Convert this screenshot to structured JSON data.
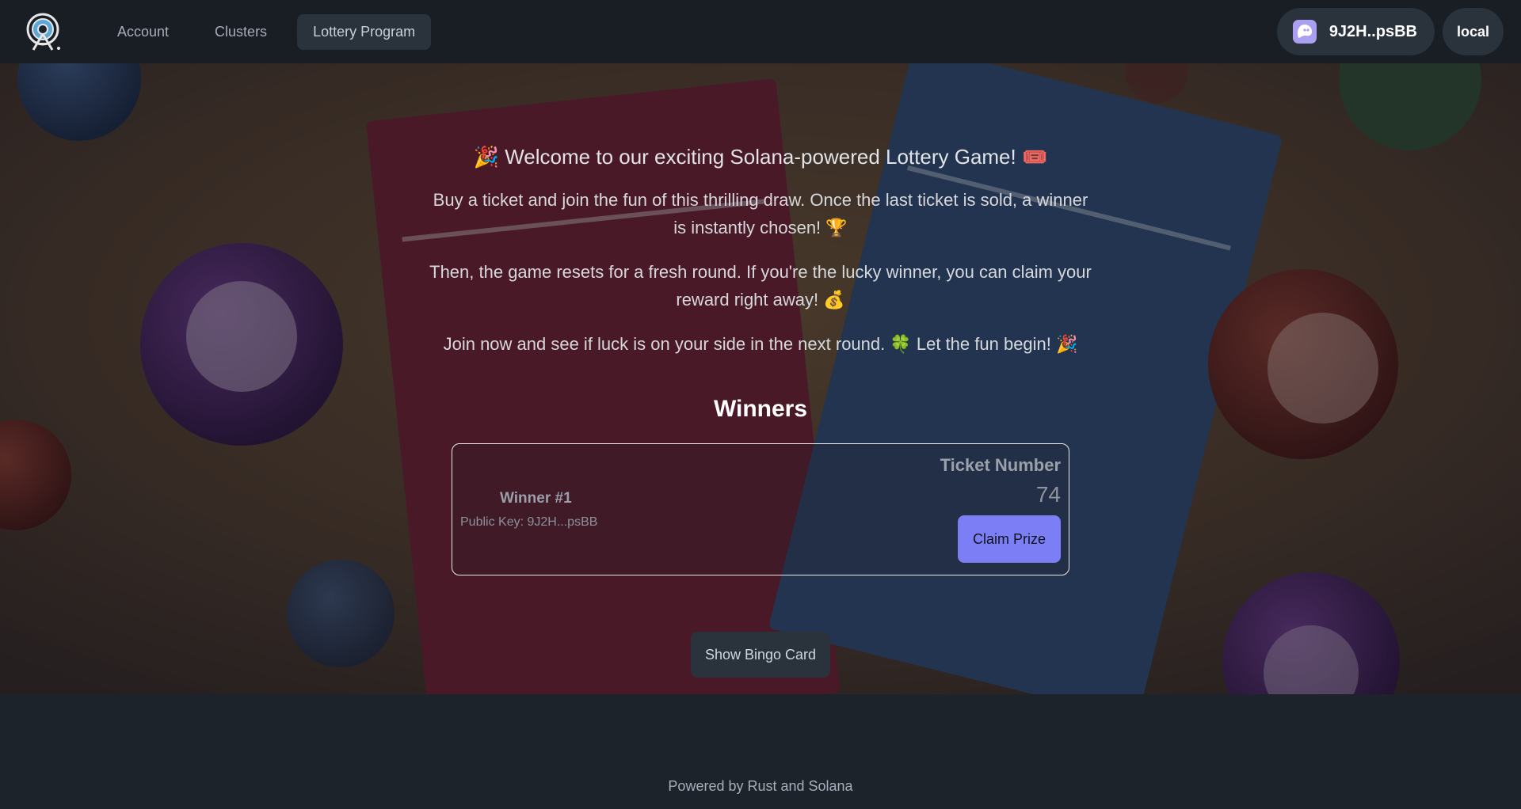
{
  "nav": {
    "links": [
      {
        "label": "Account",
        "active": false
      },
      {
        "label": "Clusters",
        "active": false
      },
      {
        "label": "Lottery Program",
        "active": true
      }
    ],
    "wallet": {
      "label": "9J2H..psBB",
      "icon": "phantom-ghost-icon"
    },
    "cluster": {
      "label": "local"
    }
  },
  "hero": {
    "welcome": "🎉 Welcome to our exciting Solana-powered Lottery Game! 🎟️",
    "paragraphs": [
      "Buy a ticket and join the fun of this thrilling draw. Once the last ticket is sold, a winner is instantly chosen! 🏆",
      "Then, the game resets for a fresh round. If you're the lucky winner, you can claim your reward right away! 💰",
      "Join now and see if luck is on your side in the next round. 🍀 Let the fun begin! 🎉"
    ]
  },
  "winners": {
    "title": "Winners",
    "items": [
      {
        "name": "Winner #1",
        "public_key": "Public Key: 9J2H...psBB",
        "ticket_label": "Ticket Number",
        "ticket_number": "74",
        "claim_label": "Claim Prize"
      }
    ]
  },
  "actions": {
    "bingo_label": "Show Bingo Card"
  },
  "footer": {
    "text": "Powered by Rust and Solana"
  },
  "colors": {
    "navbar": "#191e24",
    "surface": "#2a323c",
    "primary": "#7b7ef5",
    "page_bg": "#1d232a"
  }
}
